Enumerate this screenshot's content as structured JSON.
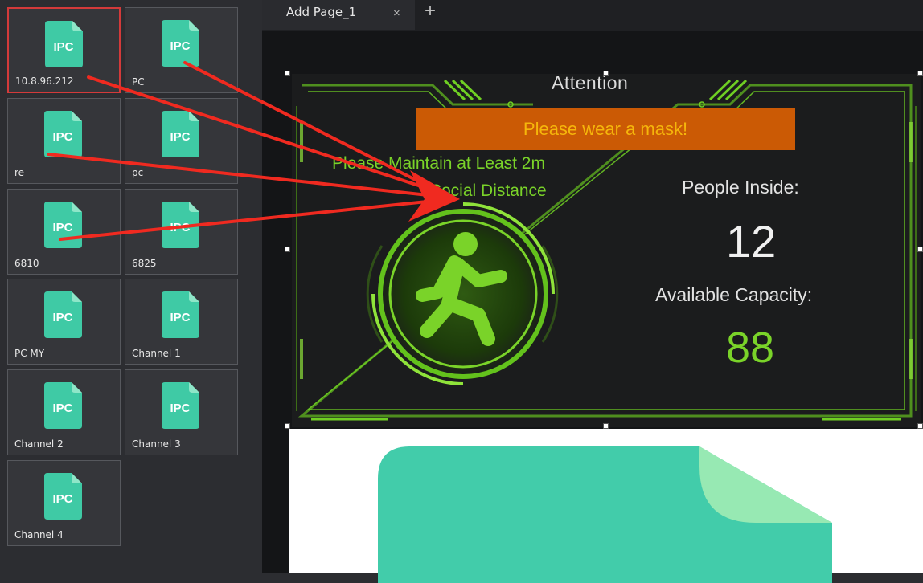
{
  "device_panel": {
    "icon_text": "IPC",
    "tiles": [
      {
        "label": "10.8.96.212",
        "selected": true
      },
      {
        "label": "PC"
      },
      {
        "label": "re"
      },
      {
        "label": "pc"
      },
      {
        "label": "6810"
      },
      {
        "label": "6825"
      },
      {
        "label": "PC MY"
      },
      {
        "label": "Channel 1"
      },
      {
        "label": "Channel 2"
      },
      {
        "label": "Channel 3"
      },
      {
        "label": "Channel 4"
      }
    ]
  },
  "tabs": {
    "active_label": "Add Page_1",
    "close_glyph": "×",
    "add_glyph": "+"
  },
  "widget": {
    "title": "Attention",
    "banner": "Please wear a mask!",
    "maintain_line1": "Please Maintain at Least 2m",
    "maintain_line2": "Social Distance",
    "people_label": "People Inside:",
    "people_value": "12",
    "capacity_label": "Available Capacity:",
    "capacity_value": "88"
  },
  "colors": {
    "accent_green": "#7ad329",
    "banner_orange": "#cb5a05",
    "banner_text": "#f5b60b",
    "icon_teal": "#3fcaa5",
    "arrow_red": "#f02a20",
    "selection_red": "#d33a3a"
  }
}
